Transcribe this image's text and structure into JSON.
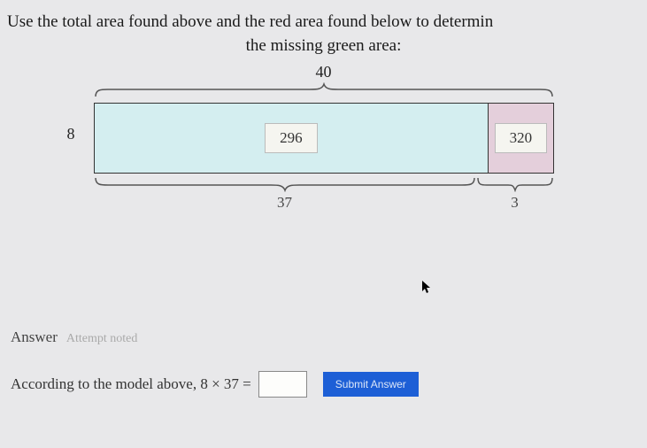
{
  "instruction": {
    "line1": "Use the total area found above and the red area found below to determin",
    "line2": "the missing green area:"
  },
  "diagram": {
    "top_width": "40",
    "left_height": "8",
    "green_area": "296",
    "red_area": "320",
    "bottom_left": "37",
    "bottom_right": "3"
  },
  "answer": {
    "label": "Answer",
    "faded": "Attempt noted",
    "equation_prefix": "According to the model above, 8 × 37 =",
    "input_value": "",
    "submit_label": "Submit Answer"
  }
}
